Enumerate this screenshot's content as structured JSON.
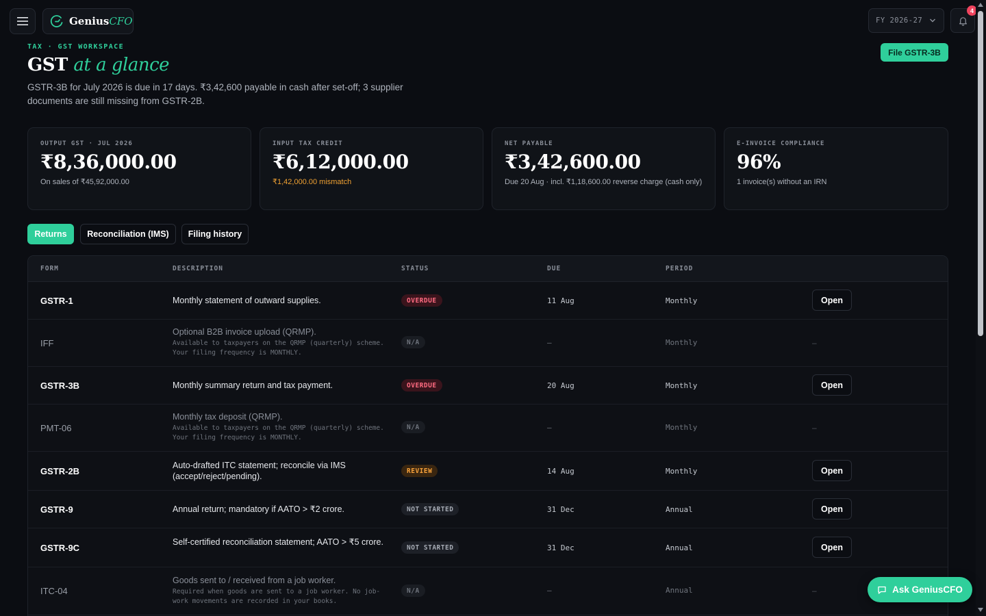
{
  "app": {
    "brand_main": "Genius",
    "brand_accent": "CFO",
    "fiscal_year": "FY 2026-27",
    "notification_count": "4"
  },
  "colors": {
    "accent": "#2fcf9b",
    "warning": "#f0a132",
    "danger": "#ff6b81",
    "background": "#0b0d12"
  },
  "header": {
    "eyebrow": "TAX · GST WORKSPACE",
    "title_main": "GST",
    "title_accent": "at a glance",
    "summary": "GSTR-3B for July 2026 is due in 17 days. ₹3,42,600 payable in cash after set-off; 3 supplier documents are still missing from GSTR-2B.",
    "file_button": "File GSTR-3B"
  },
  "kpis": [
    {
      "label": "OUTPUT GST · JUL 2026",
      "value": "₹8,36,000.00",
      "note": "On sales of ₹45,92,000.00"
    },
    {
      "label": "INPUT TAX CREDIT",
      "value": "₹6,12,000.00",
      "note": "₹1,42,000.00 mismatch"
    },
    {
      "label": "NET PAYABLE",
      "value": "₹3,42,600.00",
      "note": "Due 20 Aug · incl. ₹1,18,600.00 reverse charge (cash only)"
    },
    {
      "label": "E-INVOICE COMPLIANCE",
      "value": "96%",
      "note": "1 invoice(s) without an IRN"
    }
  ],
  "tabs": [
    {
      "label": "Returns"
    },
    {
      "label": "Reconciliation (IMS)"
    },
    {
      "label": "Filing history"
    }
  ],
  "table": {
    "columns": [
      "FORM",
      "DESCRIPTION",
      "STATUS",
      "DUE",
      "PERIOD"
    ],
    "rows": [
      {
        "form": "GSTR-1",
        "desc": "Monthly statement of outward supplies.",
        "sub": "",
        "status": "OVERDUE",
        "due": "11 Aug",
        "period": "Monthly",
        "action": "Open"
      },
      {
        "form": "IFF",
        "desc": "Optional B2B invoice upload (QRMP).",
        "sub": "Available to taxpayers on the QRMP (quarterly) scheme. Your filing frequency is MONTHLY.",
        "status": "N/A",
        "due": "—",
        "period": "Monthly",
        "action": "–"
      },
      {
        "form": "GSTR-3B",
        "desc": "Monthly summary return and tax payment.",
        "sub": "",
        "status": "OVERDUE",
        "due": "20 Aug",
        "period": "Monthly",
        "action": "Open"
      },
      {
        "form": "PMT-06",
        "desc": "Monthly tax deposit (QRMP).",
        "sub": "Available to taxpayers on the QRMP (quarterly) scheme. Your filing frequency is MONTHLY.",
        "status": "N/A",
        "due": "—",
        "period": "Monthly",
        "action": "–"
      },
      {
        "form": "GSTR-2B",
        "desc": "Auto-drafted ITC statement; reconcile via IMS (accept/reject/pending).",
        "sub": "",
        "status": "REVIEW",
        "due": "14 Aug",
        "period": "Monthly",
        "action": "Open"
      },
      {
        "form": "GSTR-9",
        "desc": "Annual return; mandatory if AATO > ₹2 crore.",
        "sub": "",
        "status": "NOT STARTED",
        "due": "31 Dec",
        "period": "Annual",
        "action": "Open"
      },
      {
        "form": "GSTR-9C",
        "desc": "Self-certified reconciliation statement; AATO > ₹5 crore.",
        "sub": "",
        "status": "NOT STARTED",
        "due": "31 Dec",
        "period": "Annual",
        "action": "Open"
      },
      {
        "form": "ITC-04",
        "desc": "Goods sent to / received from a job worker.",
        "sub": "Required when goods are sent to a job worker. No job-work movements are recorded in your books.",
        "status": "N/A",
        "due": "—",
        "period": "Annual",
        "action": "–"
      }
    ]
  },
  "assistant": {
    "label": "Ask GeniusCFO"
  }
}
